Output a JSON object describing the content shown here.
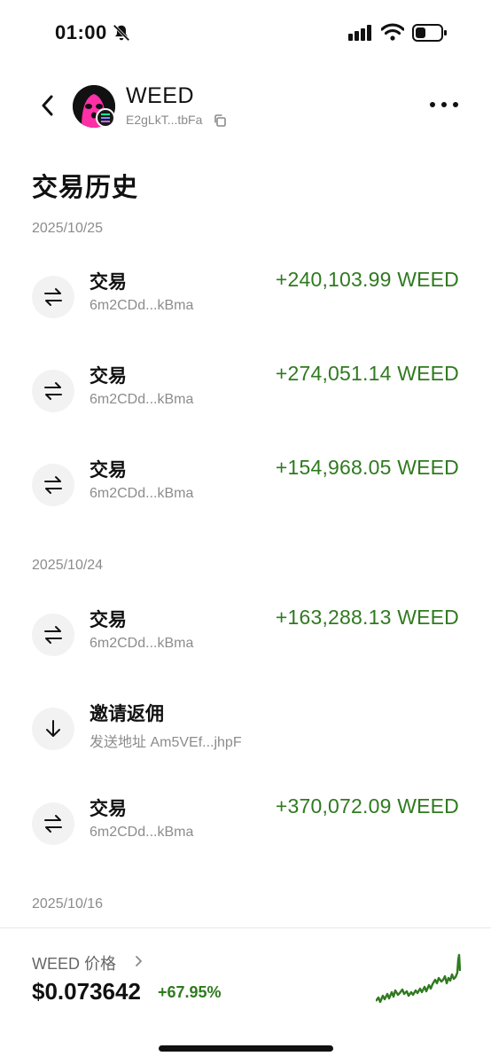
{
  "status_bar": {
    "time": "01:00"
  },
  "header": {
    "token_name": "WEED",
    "token_address": "E2gLkT...tbFa"
  },
  "page_title": "交易历史",
  "groups": [
    {
      "date": "2025/10/25",
      "items": [
        {
          "icon": "swap-icon",
          "title": "交易",
          "subtitle": "6m2CDd...kBma",
          "amount": "+240,103.99 WEED"
        },
        {
          "icon": "swap-icon",
          "title": "交易",
          "subtitle": "6m2CDd...kBma",
          "amount": "+274,051.14 WEED"
        },
        {
          "icon": "swap-icon",
          "title": "交易",
          "subtitle": "6m2CDd...kBma",
          "amount": "+154,968.05 WEED"
        }
      ]
    },
    {
      "date": "2025/10/24",
      "items": [
        {
          "icon": "swap-icon",
          "title": "交易",
          "subtitle": "6m2CDd...kBma",
          "amount": "+163,288.13 WEED"
        },
        {
          "icon": "arrow-down-icon",
          "title": "邀请返佣",
          "subtitle": "发送地址 Am5VEf...jhpF",
          "amount": ""
        },
        {
          "icon": "swap-icon",
          "title": "交易",
          "subtitle": "6m2CDd...kBma",
          "amount": "+370,072.09 WEED"
        }
      ]
    },
    {
      "date": "2025/10/16",
      "items": []
    }
  ],
  "price_panel": {
    "label": "WEED 价格",
    "price": "$0.073642",
    "change": "+67.95%"
  },
  "colors": {
    "positive": "#2f7a1f",
    "avatar": "#ff2fa6"
  }
}
